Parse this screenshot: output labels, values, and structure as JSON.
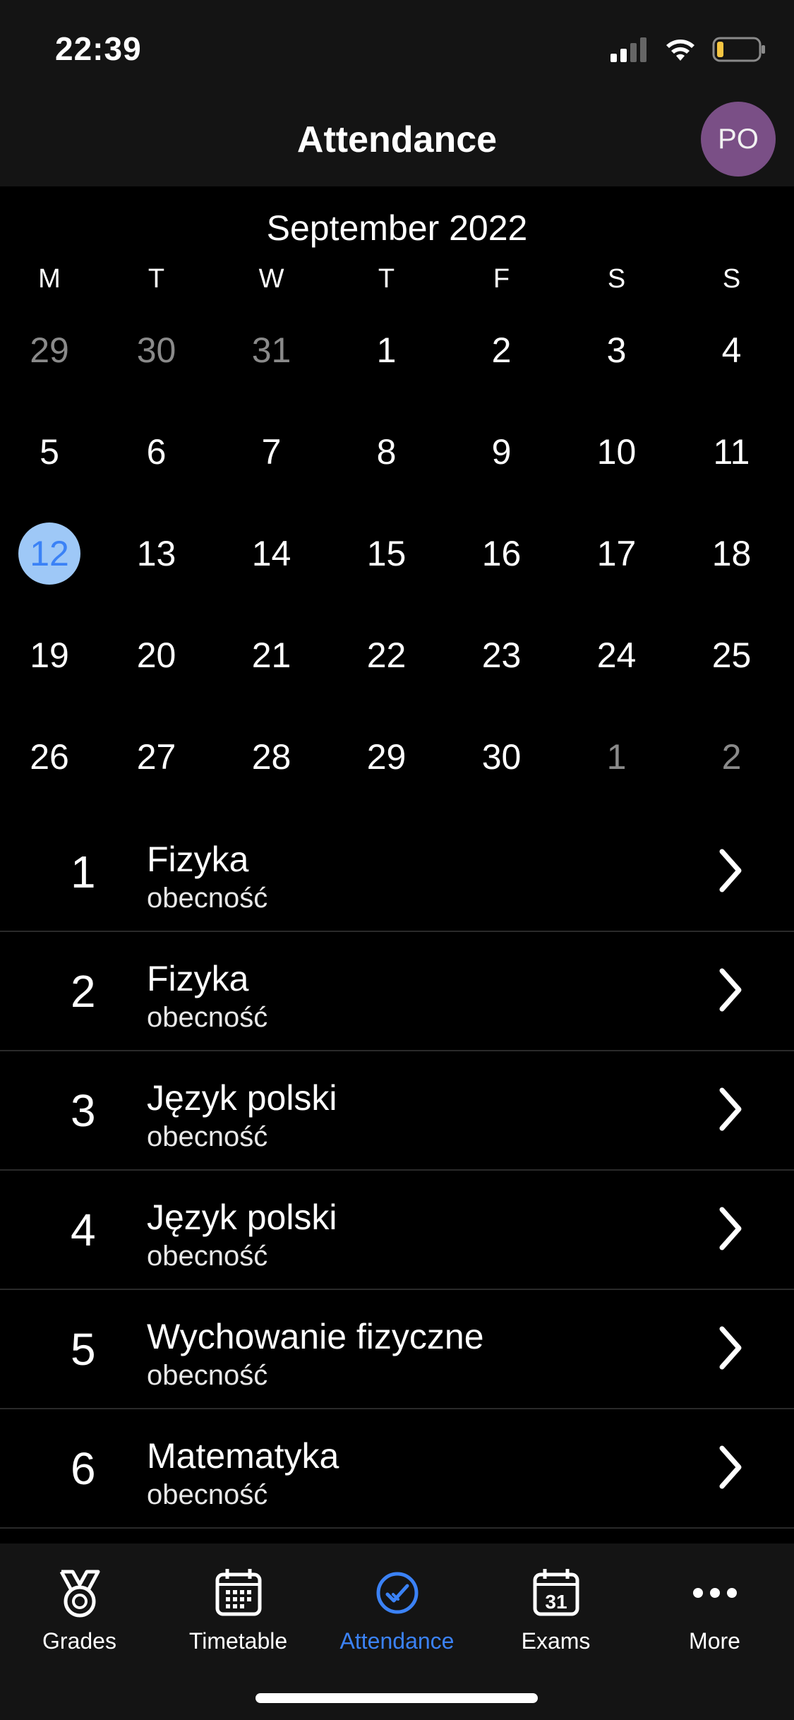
{
  "status": {
    "time": "22:39"
  },
  "header": {
    "title": "Attendance",
    "avatar_initials": "PO",
    "avatar_color": "#7a4f86"
  },
  "calendar": {
    "month_label": "September 2022",
    "weekdays": [
      "M",
      "T",
      "W",
      "T",
      "F",
      "S",
      "S"
    ],
    "weeks": [
      [
        {
          "d": "29",
          "muted": true
        },
        {
          "d": "30",
          "muted": true
        },
        {
          "d": "31",
          "muted": true
        },
        {
          "d": "1"
        },
        {
          "d": "2"
        },
        {
          "d": "3"
        },
        {
          "d": "4"
        }
      ],
      [
        {
          "d": "5"
        },
        {
          "d": "6"
        },
        {
          "d": "7"
        },
        {
          "d": "8"
        },
        {
          "d": "9"
        },
        {
          "d": "10"
        },
        {
          "d": "11"
        }
      ],
      [
        {
          "d": "12",
          "today": true
        },
        {
          "d": "13"
        },
        {
          "d": "14"
        },
        {
          "d": "15"
        },
        {
          "d": "16"
        },
        {
          "d": "17"
        },
        {
          "d": "18"
        }
      ],
      [
        {
          "d": "19"
        },
        {
          "d": "20"
        },
        {
          "d": "21"
        },
        {
          "d": "22"
        },
        {
          "d": "23"
        },
        {
          "d": "24"
        },
        {
          "d": "25"
        }
      ],
      [
        {
          "d": "26"
        },
        {
          "d": "27"
        },
        {
          "d": "28"
        },
        {
          "d": "29"
        },
        {
          "d": "30"
        },
        {
          "d": "1",
          "muted": true
        },
        {
          "d": "2",
          "muted": true
        }
      ]
    ],
    "today_color": "#9ec8f7"
  },
  "lessons": [
    {
      "number": "1",
      "subject": "Fizyka",
      "status": "obecność"
    },
    {
      "number": "2",
      "subject": "Fizyka",
      "status": "obecność"
    },
    {
      "number": "3",
      "subject": "Język polski",
      "status": "obecność"
    },
    {
      "number": "4",
      "subject": "Język polski",
      "status": "obecność"
    },
    {
      "number": "5",
      "subject": "Wychowanie fizyczne",
      "status": "obecność"
    },
    {
      "number": "6",
      "subject": "Matematyka",
      "status": "obecność"
    }
  ],
  "tabs": [
    {
      "label": "Grades",
      "icon": "medal-icon"
    },
    {
      "label": "Timetable",
      "icon": "calendar-grid-icon"
    },
    {
      "label": "Attendance",
      "icon": "check-circle-icon",
      "active": true
    },
    {
      "label": "Exams",
      "icon": "calendar-31-icon",
      "icon_text": "31"
    },
    {
      "label": "More",
      "icon": "ellipsis-icon"
    }
  ],
  "accent_color": "#3b82f6"
}
